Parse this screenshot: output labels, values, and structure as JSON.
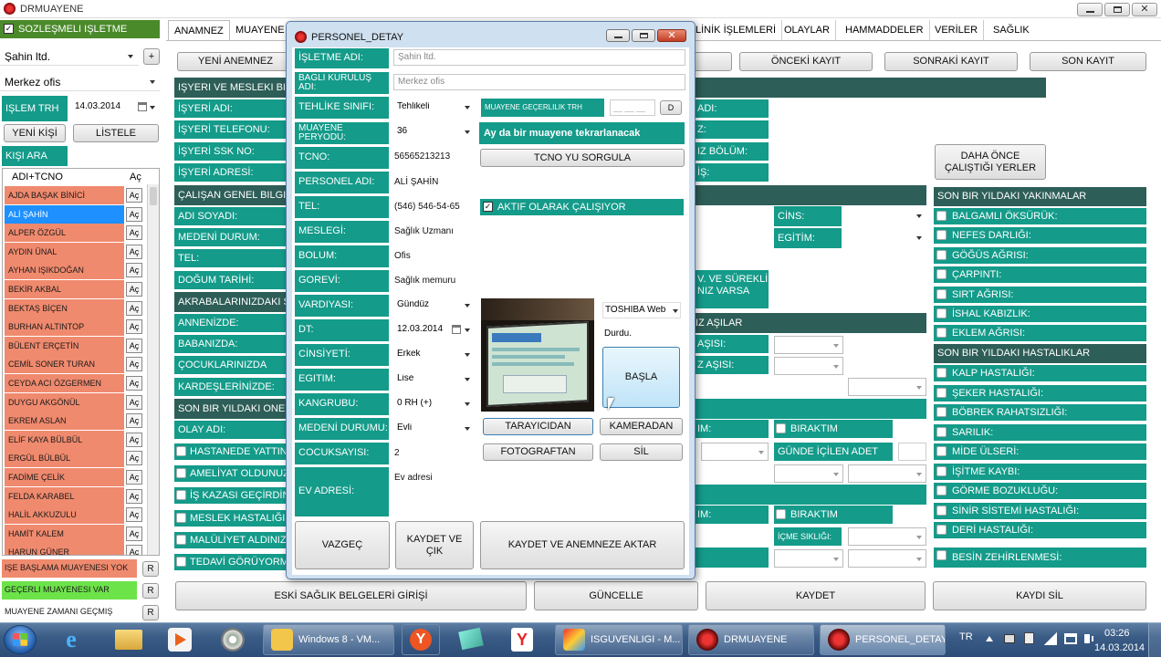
{
  "window": {
    "title": "DRMUAYENE"
  },
  "left": {
    "sozlesmeli_label": "SÖZLEŞMELİ İŞLETME",
    "company": "Şahin ltd.",
    "plus": "+",
    "branch": "Merkez ofis",
    "islem_trh_label": "İŞLEM TRH",
    "islem_trh_value": "14.03.2014",
    "yeni_kisi": "YENİ KİŞİ",
    "listele": "LİSTELE",
    "kisi_ara": "KİŞİ ARA",
    "col_name": "ADI+TCNO",
    "col_ac": "Aç",
    "ac_button": "Aç",
    "people": [
      "AJDA BAŞAK BİNİCİ",
      "ALİ ŞAHİN",
      "ALPER ÖZGÜL",
      "AYDIN ÜNAL",
      "AYHAN IŞIKDOĞAN",
      "BEKİR AKBAL",
      "BEKTAŞ BİÇEN",
      "BURHAN ALTINTOP",
      "BÜLENT ERÇETİN",
      "CEMİL SONER TURAN",
      "CEYDA ACI ÖZGERMEN",
      "DUYGU AKGÖNÜL",
      "EKREM ASLAN",
      "ELİF KAYA BÜLBÜL",
      "ERGÜL BÜLBÜL",
      "FADİME ÇELİK",
      "FELDA KARABEL",
      "HALİL AKKUZULU",
      "HAMİT KALEM",
      "HARUN GÜNER"
    ],
    "legend": [
      {
        "label": "İŞE BAŞLAMA MUAYENESİ YOK",
        "color": "#f08a6e"
      },
      {
        "label": "GEÇERLİ MUAYENESİ VAR",
        "color": "#6de34a"
      },
      {
        "label": "MUAYENE ZAMANI GEÇMİŞ",
        "color": "#ffffff"
      }
    ],
    "r_button": "R"
  },
  "tabs": [
    "ANAMNEZ",
    "MUAYENE",
    "LİNİK İŞLEMLERİ",
    "OLAYLAR",
    "HAMMADDELER",
    "VERİLER",
    "SAĞLIK"
  ],
  "toolbar": {
    "yeni_anemnez": "YENİ ANEMNEZ",
    "onceki": "ÖNCEKİ KAYIT",
    "sonraki": "SONRAKİ KAYIT",
    "son": "SON KAYIT"
  },
  "main": {
    "sections": {
      "isyeri": "İŞYERİ VE MESLEKİ BİLGİ",
      "calisan": "ÇALIŞAN GENEL BİLGİLE",
      "akrabalar": "AKRABALARINIZDAKİ SÜ",
      "son_bir_yil": "SON BİR YILDAKİ ÖNEML"
    },
    "isyeri_fields": [
      "İŞYERİ ADI:",
      "İŞYERİ TELEFONU:",
      "İŞYERİ SSK NO:",
      "İŞYERİ ADRESİ:"
    ],
    "calisan_fields": [
      "ADI SOYADI:",
      "MEDENİ DURUM:",
      "TEL:",
      "DOĞUM TARİHİ:"
    ],
    "akraba_fields": [
      "ANNENİZDE:",
      "BABANIZDA:",
      "ÇOCUKLARINIZDA",
      "KARDEŞLERİNİZDE:"
    ],
    "olay_adi": "OLAY ADI:",
    "olay_items": [
      "HASTANEDE YATTINI",
      "AMELİYAT OLDUNUZ",
      "İŞ KAZASI GEÇİRDİNİ",
      "MESLEK HASTALIĞI ?",
      "MALÜLİYET ALDINIZM",
      "TEDAVİ GÖRÜYORMU"
    ],
    "mid_labels": {
      "adi": "ADI:",
      "z": "Z:",
      "iz_bolum": "IZ BÖLÜM:",
      "is": "İŞ:",
      "cins": "CİNS:",
      "egitim": "EGİTİM:",
      "surekli": "V. VE SÜREKLİ\nNIZ VARSA",
      "asilar": "IZ AŞILAR",
      "asisi1": "AŞISI:",
      "asisi2": "Z AŞISI:",
      "im1": "IM:",
      "im2": "IM:",
      "biraktim": "BIRAKTIM",
      "gunde": "GÜNDE İÇİLEN ADET",
      "icme": "İÇME SIKLIĞI:"
    },
    "daha_once": "DAHA ÖNCE ÇALIŞTIĞI YERLER",
    "yakinmalar_title": "SON BİR YILDAKİ YAKINMALAR",
    "yakinmalar": [
      "BALGAMLI ÖKSÜRÜK:",
      "NEFES DARLIĞI:",
      "GÖĞÜS AĞRISI:",
      "ÇARPINTI:",
      "SIRT AĞRISI:",
      "İSHAL KABIZLIK:",
      "EKLEM AĞRISI:"
    ],
    "hastaliklar_title": "SON BİR YILDAKİ HASTALIKLAR",
    "hastaliklar": [
      "KALP HASTALIĞI:",
      "ŞEKER HASTALIĞI:",
      "BÖBREK RAHATSIZLIĞI:",
      "SARILIK:",
      "MİDE ÜLSERİ:",
      "İŞİTME KAYBI:",
      "GÖRME BOZUKLUĞU:",
      "SİNİR SİSTEMİ HASTALIĞI:",
      "DERİ HASTALIĞI:",
      "BESİN ZEHİRLENMESİ:"
    ],
    "bottom": {
      "eski": "ESKİ SAĞLIK BELGELERİ GİRİŞİ",
      "guncelle": "GÜNCELLE",
      "kaydet": "KAYDET",
      "kaydi_sil": "KAYDI SİL"
    }
  },
  "modal": {
    "title": "PERSONEL_DETAY",
    "isletme_adi_label": "İŞLETME ADI:",
    "isletme_adi_value": "Şahin ltd.",
    "bagli_label": "BAGLI KURULUŞ ADI:",
    "bagli_value": "Merkez ofis",
    "tehlike_label": "TEHLİKE SINIFI:",
    "tehlike_value": "Tehlikeli",
    "muayene_gec_label": "MUAYENE GEÇERLİLİK TRH",
    "muayene_gec_value": "__ __ __",
    "d_button": "D",
    "periyot_label": "MUAYENE PERYODU:",
    "periyot_value": "36",
    "tekrar": "Ay da bir muayene tekrarlanacak",
    "tcno_label": "TCNO:",
    "tcno_value": "56565213213",
    "tcno_sorgula": "TCNO YU SORGULA",
    "personel_label": "PERSONEL ADI:",
    "personel_value": "ALİ ŞAHİN",
    "tel_label": "TEL:",
    "tel_value": "(546) 546-54-65",
    "aktif_label": "AKTİF OLARAK ÇALIŞIYOR",
    "meslek_label": "MESLEGİ:",
    "meslek_value": "Sağlık Uzmanı",
    "bolum_label": "BOLUM:",
    "bolum_value": "Ofis",
    "gorev_label": "GOREVİ:",
    "gorev_value": "Sağlık memuru",
    "vardiya_label": "VARDIYASI:",
    "vardiya_value": "Gündüz",
    "dt_label": "DT:",
    "dt_value": "12.03.2014",
    "cins_label": "CİNSİYETİ:",
    "cins_value": "Erkek",
    "egitim_label": "EGITIM:",
    "egitim_value": "Lise",
    "kan_label": "KANGRUBU:",
    "kan_value": "0 RH (+)",
    "medeni_label": "MEDENİ DURUMU:",
    "medeni_value": "Evli",
    "cocuk_label": "COCUKSAYISI:",
    "cocuk_value": "2",
    "ev_label": "EV ADRESİ:",
    "ev_value": "Ev adresi",
    "camera_value": "TOSHIBA Web",
    "durdu": "Durdu.",
    "basla": "BAŞLA",
    "tarayicidan": "TARAYICIDAN",
    "kameradan": "KAMERADAN",
    "fotograftan": "FOTOGRAFTAN",
    "sil": "SİL",
    "vazgec": "VAZGEÇ",
    "kaydet_cik": "KAYDET VE\nÇIK",
    "kaydet_aktar": "KAYDET VE ANEMNEZE AKTAR"
  },
  "taskbar": {
    "items": [
      "Windows 8 - VM...",
      "ISGUVENLIGI - M...",
      "DRMUAYENE",
      "PERSONEL_DETAY"
    ],
    "lang": "TR",
    "time": "03:26",
    "date": "14.03.2014"
  }
}
